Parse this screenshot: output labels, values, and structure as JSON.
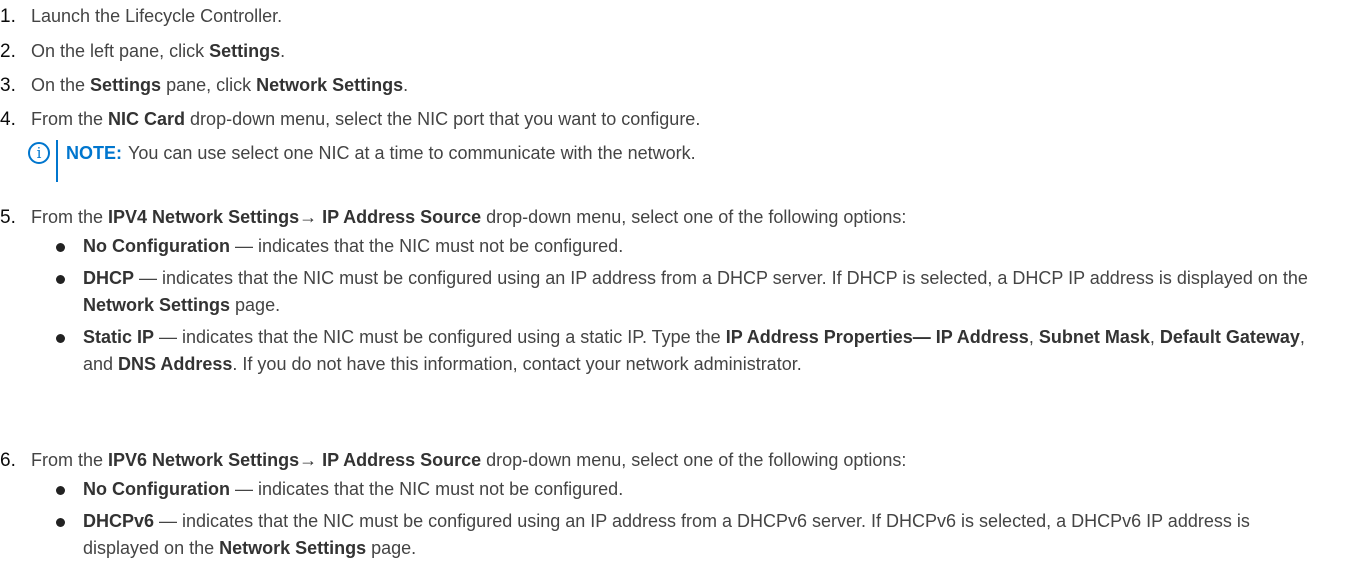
{
  "steps": [
    {
      "num": "1.",
      "text": "Launch the Lifecycle Controller."
    },
    {
      "num": "2.",
      "pre": "On the left pane, click ",
      "b1": "Settings",
      "post": "."
    },
    {
      "num": "3.",
      "pre": "On the ",
      "b1": "Settings",
      "mid": " pane, click ",
      "b2": "Network Settings",
      "post": "."
    },
    {
      "num": "4.",
      "pre": "From the ",
      "b1": "NIC Card",
      "post": " drop-down menu, select the NIC port that you want to configure."
    },
    {
      "num": "5.",
      "pre": "From the ",
      "b1": "IPV4 Network Settings→ IP Address Source",
      "post": " drop-down menu, select one of the following options:"
    },
    {
      "num": "6.",
      "pre": "From the ",
      "b1": "IPV6 Network Settings→ IP Address Source",
      "post": " drop-down menu, select one of the following options:"
    }
  ],
  "note": {
    "icon": "info-circle-icon",
    "icon_glyph": "i",
    "label": "NOTE:",
    "text": "You can use select one NIC at a time to communicate with the network."
  },
  "ipv4_options": [
    {
      "b": "No Configuration",
      "text": " — indicates that the NIC must not be configured."
    },
    {
      "b": "DHCP",
      "text": " — indicates that the NIC must be configured using an IP address from a DHCP server. If DHCP is selected, a DHCP IP address is displayed on the ",
      "b2": "Network Settings",
      "tail": " page."
    },
    {
      "b": "Static IP",
      "text": " — indicates that the NIC must be configured using a static IP. Type the ",
      "b2": "IP Address Properties— IP Address",
      "s1": ", ",
      "b3": "Subnet Mask",
      "s2": ", ",
      "b4": "Default Gateway",
      "s3": ", and ",
      "b5": "DNS Address",
      "tail": ". If you do not have this information, contact your network administrator."
    }
  ],
  "ipv6_options": [
    {
      "b": "No Configuration",
      "text": " — indicates that the NIC must not be configured."
    },
    {
      "b": "DHCPv6",
      "text": " — indicates that the NIC must be configured using an IP address from a DHCPv6 server. If DHCPv6 is selected, a DHCPv6 IP address is displayed on the ",
      "b2": "Network Settings",
      "tail": " page."
    }
  ]
}
